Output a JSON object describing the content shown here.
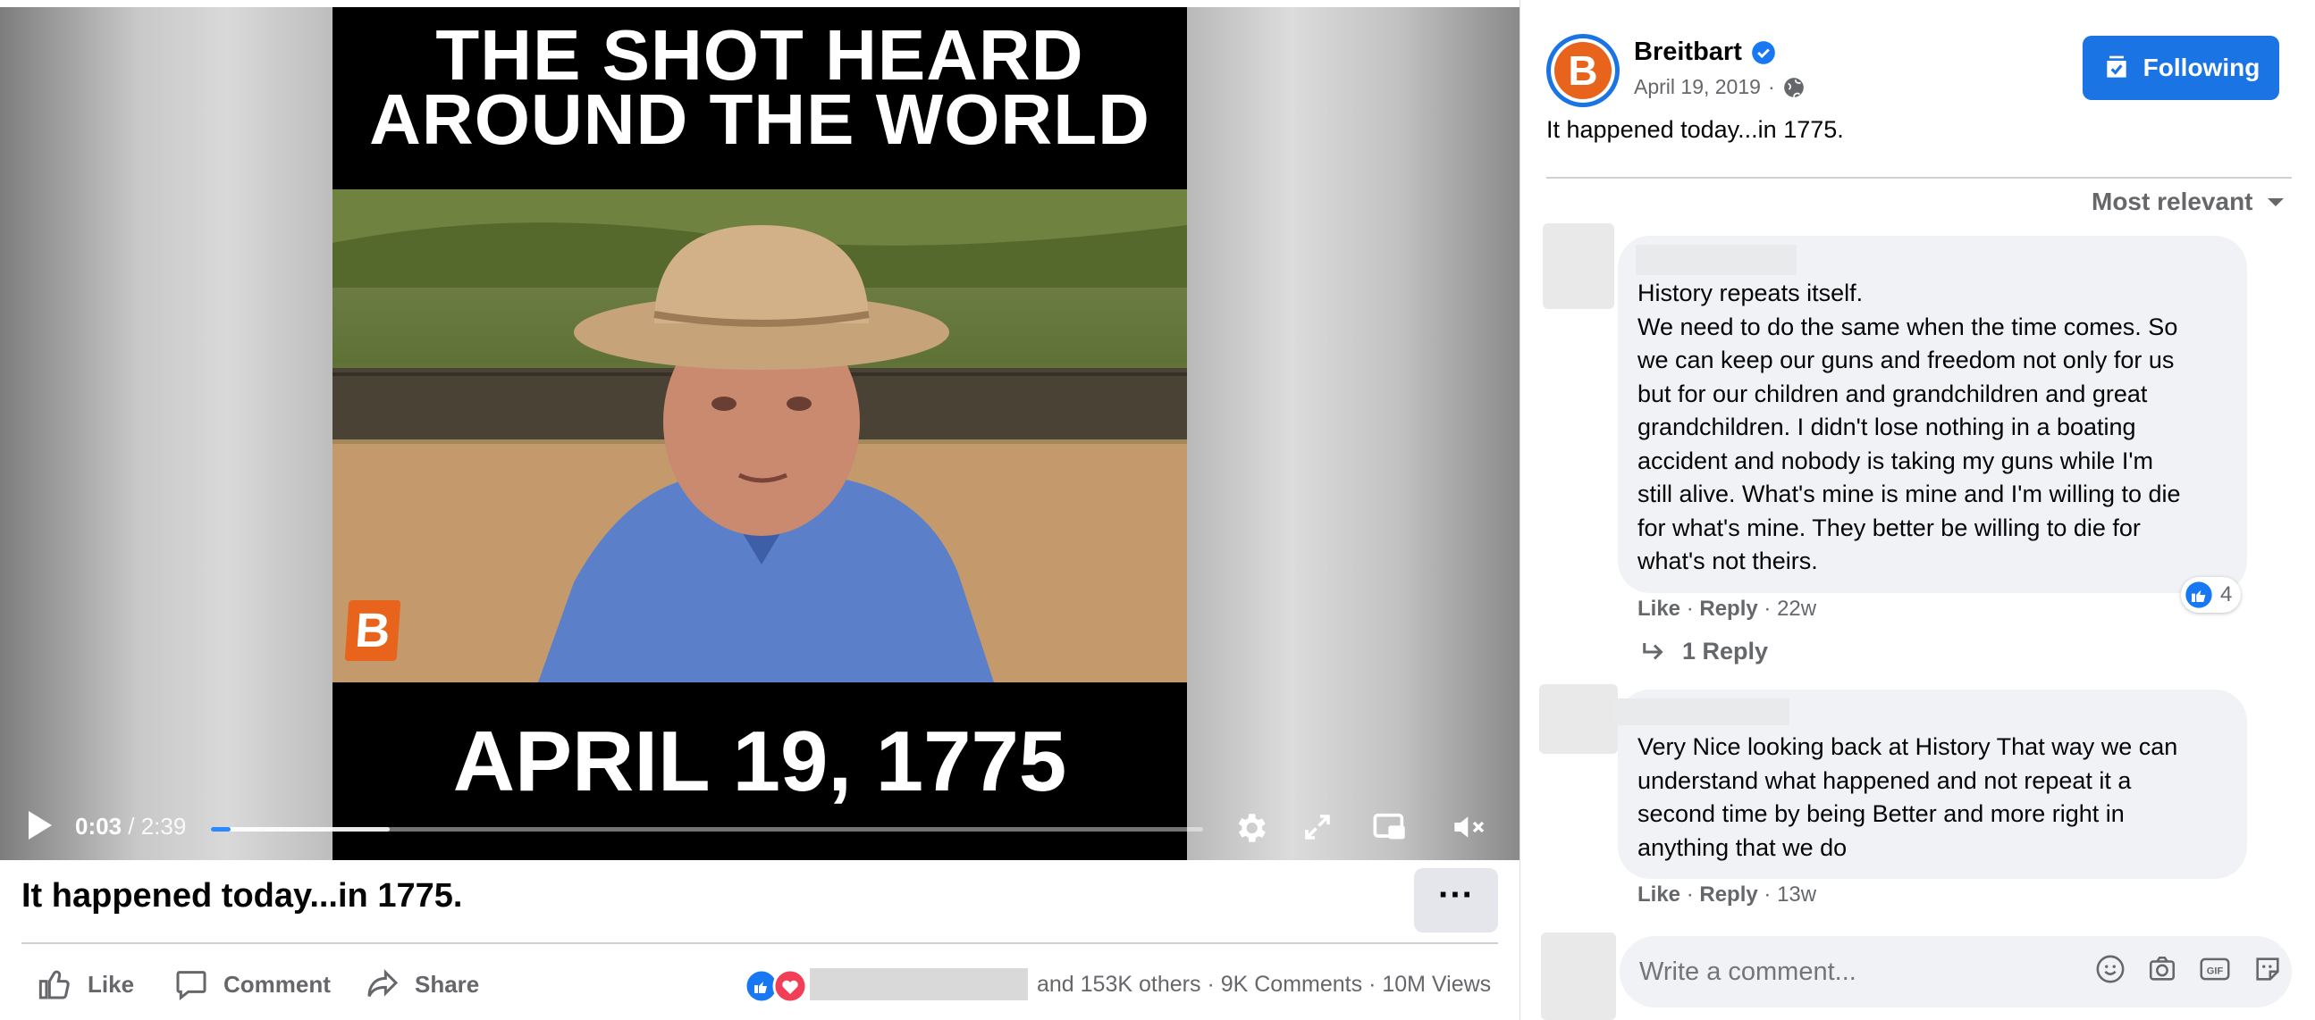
{
  "video": {
    "title_line1": "THE SHOT HEARD",
    "title_line2": "AROUND THE WORLD",
    "date_caption": "APRIL 19, 1775",
    "logo_letter": "B",
    "current_time": "0:03",
    "time_sep": " / ",
    "duration": "2:39",
    "played_fraction": 0.02,
    "buffered_fraction": 0.18
  },
  "post": {
    "title": "It happened today...in 1775.",
    "more_label": "···",
    "actions": {
      "like": "Like",
      "comment": "Comment",
      "share": "Share"
    },
    "reactions_text": "and 153K others",
    "comments_count": "9K Comments",
    "views": "10M Views",
    "sep": "·"
  },
  "page": {
    "name": "Breitbart",
    "logo_letter": "B",
    "date": "April 19, 2019",
    "date_sep": "·",
    "follow_label": "Following",
    "caption": "It happened today...in 1775.",
    "sort_label": "Most relevant"
  },
  "comments": [
    {
      "lines": [
        "History repeats itself.",
        "We need to do the same when the time comes. So",
        "we can keep our guns and freedom not only for us",
        "but for our children and grandchildren and great",
        "grandchildren. I didn't lose nothing in a boating",
        "accident and nobody is taking my guns while I'm",
        "still alive. What's mine is mine and I'm willing to die",
        "for what's mine. They better be willing to die for",
        "what's not theirs."
      ],
      "like": "Like",
      "reply": "Reply",
      "age": "22w",
      "reaction_count": "4",
      "replies_label": "1 Reply"
    },
    {
      "lines": [
        "Very Nice looking back at History That way we can",
        "understand what happened and not repeat it a",
        "second time by being Better and more right in",
        "anything that we do"
      ],
      "like": "Like",
      "reply": "Reply",
      "age": "13w"
    }
  ],
  "composer": {
    "placeholder": "Write a comment..."
  },
  "colors": {
    "accent": "#1b74e4",
    "brand": "#e8641c",
    "like_blue": "#1877f2",
    "love_red": "#f33e58"
  }
}
